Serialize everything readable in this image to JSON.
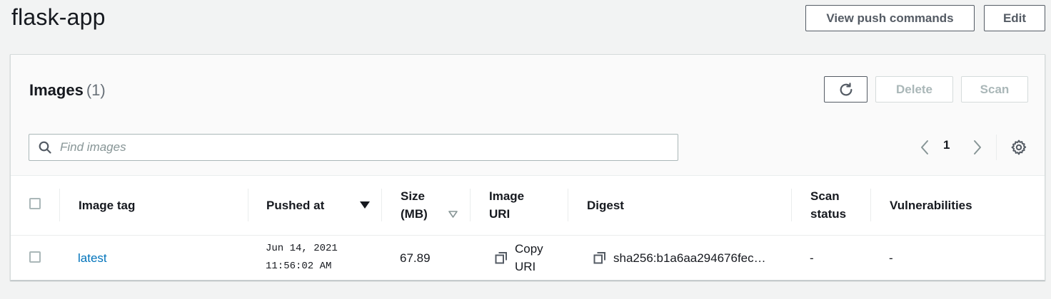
{
  "page": {
    "title": "flask-app",
    "view_push_label": "View push commands",
    "edit_label": "Edit"
  },
  "images": {
    "title": "Images",
    "count": "(1)",
    "delete_label": "Delete",
    "scan_label": "Scan",
    "search_placeholder": "Find images",
    "search_value": "",
    "page_number": "1"
  },
  "table": {
    "headers": {
      "image_tag": "Image tag",
      "pushed_at": "Pushed at",
      "size_l1": "Size",
      "size_l2": "(MB)",
      "uri_l1": "Image",
      "uri_l2": "URI",
      "digest": "Digest",
      "scan_l1": "Scan",
      "scan_l2": "status",
      "vulnerabilities": "Vulnerabilities"
    },
    "rows": [
      {
        "image_tag": "latest",
        "pushed_date": "Jun 14, 2021",
        "pushed_time": "11:56:02 AM",
        "size": "67.89",
        "uri_l1": "Copy",
        "uri_l2": "URI",
        "digest": "sha256:b1a6aa294676fec…",
        "scan_status": "-",
        "vulnerabilities": "-"
      }
    ]
  },
  "icons": {
    "search": "search-icon",
    "refresh": "refresh-icon",
    "prev": "chevron-left-icon",
    "next": "chevron-right-icon",
    "settings": "gear-icon",
    "sort_desc": "sort-descending-icon",
    "sort_neutral": "sort-icon",
    "copy": "copy-icon"
  },
  "colors": {
    "background": "#f2f3f3",
    "link": "#0073bb",
    "text": "#16191f",
    "muted": "#687078",
    "disabled": "#aab7b8"
  }
}
